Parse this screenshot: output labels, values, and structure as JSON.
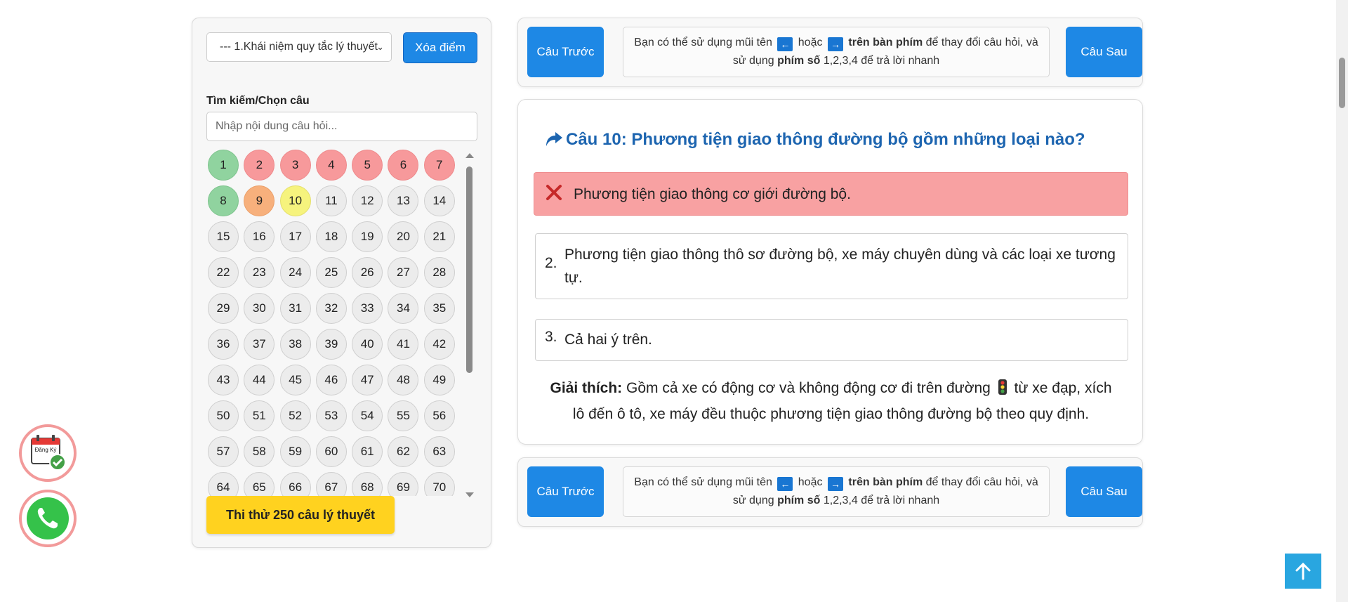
{
  "sidebar": {
    "chapter_select_value": "--- 1.Khái niệm quy tắc lý thuyết",
    "clear_button": "Xóa điểm",
    "search_label": "Tìm kiếm/Chọn câu",
    "search_placeholder": "Nhập nội dung câu hỏi...",
    "exam_button": "Thi thử 250 câu lý thuyết",
    "question_numbers": [
      1,
      2,
      3,
      4,
      5,
      6,
      7,
      8,
      9,
      10,
      11,
      12,
      13,
      14,
      15,
      16,
      17,
      18,
      19,
      20,
      21,
      22,
      23,
      24,
      25,
      26,
      27,
      28,
      29,
      30,
      31,
      32,
      33,
      34,
      35,
      36,
      37,
      38,
      39,
      40,
      41,
      42,
      43,
      44,
      45,
      46,
      47,
      48,
      49,
      50,
      51,
      52,
      53,
      54,
      55,
      56,
      57,
      58,
      59,
      60,
      61,
      62,
      63,
      64,
      65,
      66,
      67,
      68,
      69,
      70
    ],
    "status": {
      "correct": [
        1,
        8
      ],
      "wrong": [
        2,
        3,
        4,
        5,
        6,
        7
      ],
      "partial": [
        9
      ],
      "current": [
        10
      ]
    }
  },
  "nav": {
    "prev_label": "Câu Trước",
    "next_label": "Câu Sau",
    "hint_part1": "Bạn có thể sử dụng mũi tên",
    "hint_or": "hoặc",
    "hint_keyboard": "trên bàn phím",
    "hint_part2": "để thay đổi câu hỏi, và",
    "hint_part3": "sử dụng",
    "hint_numkeys": "phím số",
    "hint_part4": "1,2,3,4 để trả lời nhanh"
  },
  "question": {
    "title": "Câu 10: Phương tiện giao thông đường bộ gồm những loại nào?",
    "answers": [
      {
        "num": "",
        "text": "Phương tiện giao thông cơ giới đường bộ.",
        "state": "wrong-selected"
      },
      {
        "num": "2.",
        "text": "Phương tiện giao thông thô sơ đường bộ, xe máy chuyên dùng và các loại xe tương tự."
      },
      {
        "num": "3.",
        "text": "Cả hai ý trên."
      }
    ],
    "explanation_label": "Giải thích:",
    "explanation_part1": "Gồm cả xe có động cơ và không động cơ đi trên đường",
    "explanation_part2": "từ xe đạp, xích lô đến ô tô, xe máy đều thuộc phương tiện giao thông đường bộ theo quy định."
  },
  "floating": {
    "register_icon_text": "Đăng Ký"
  },
  "colors": {
    "primary": "#1e88e5",
    "title": "#1d65b0",
    "correct": "#90d39f",
    "wrong": "#f7999b",
    "partial": "#f7b07c",
    "current": "#f6f37d",
    "exam_button": "#ffd21f"
  }
}
